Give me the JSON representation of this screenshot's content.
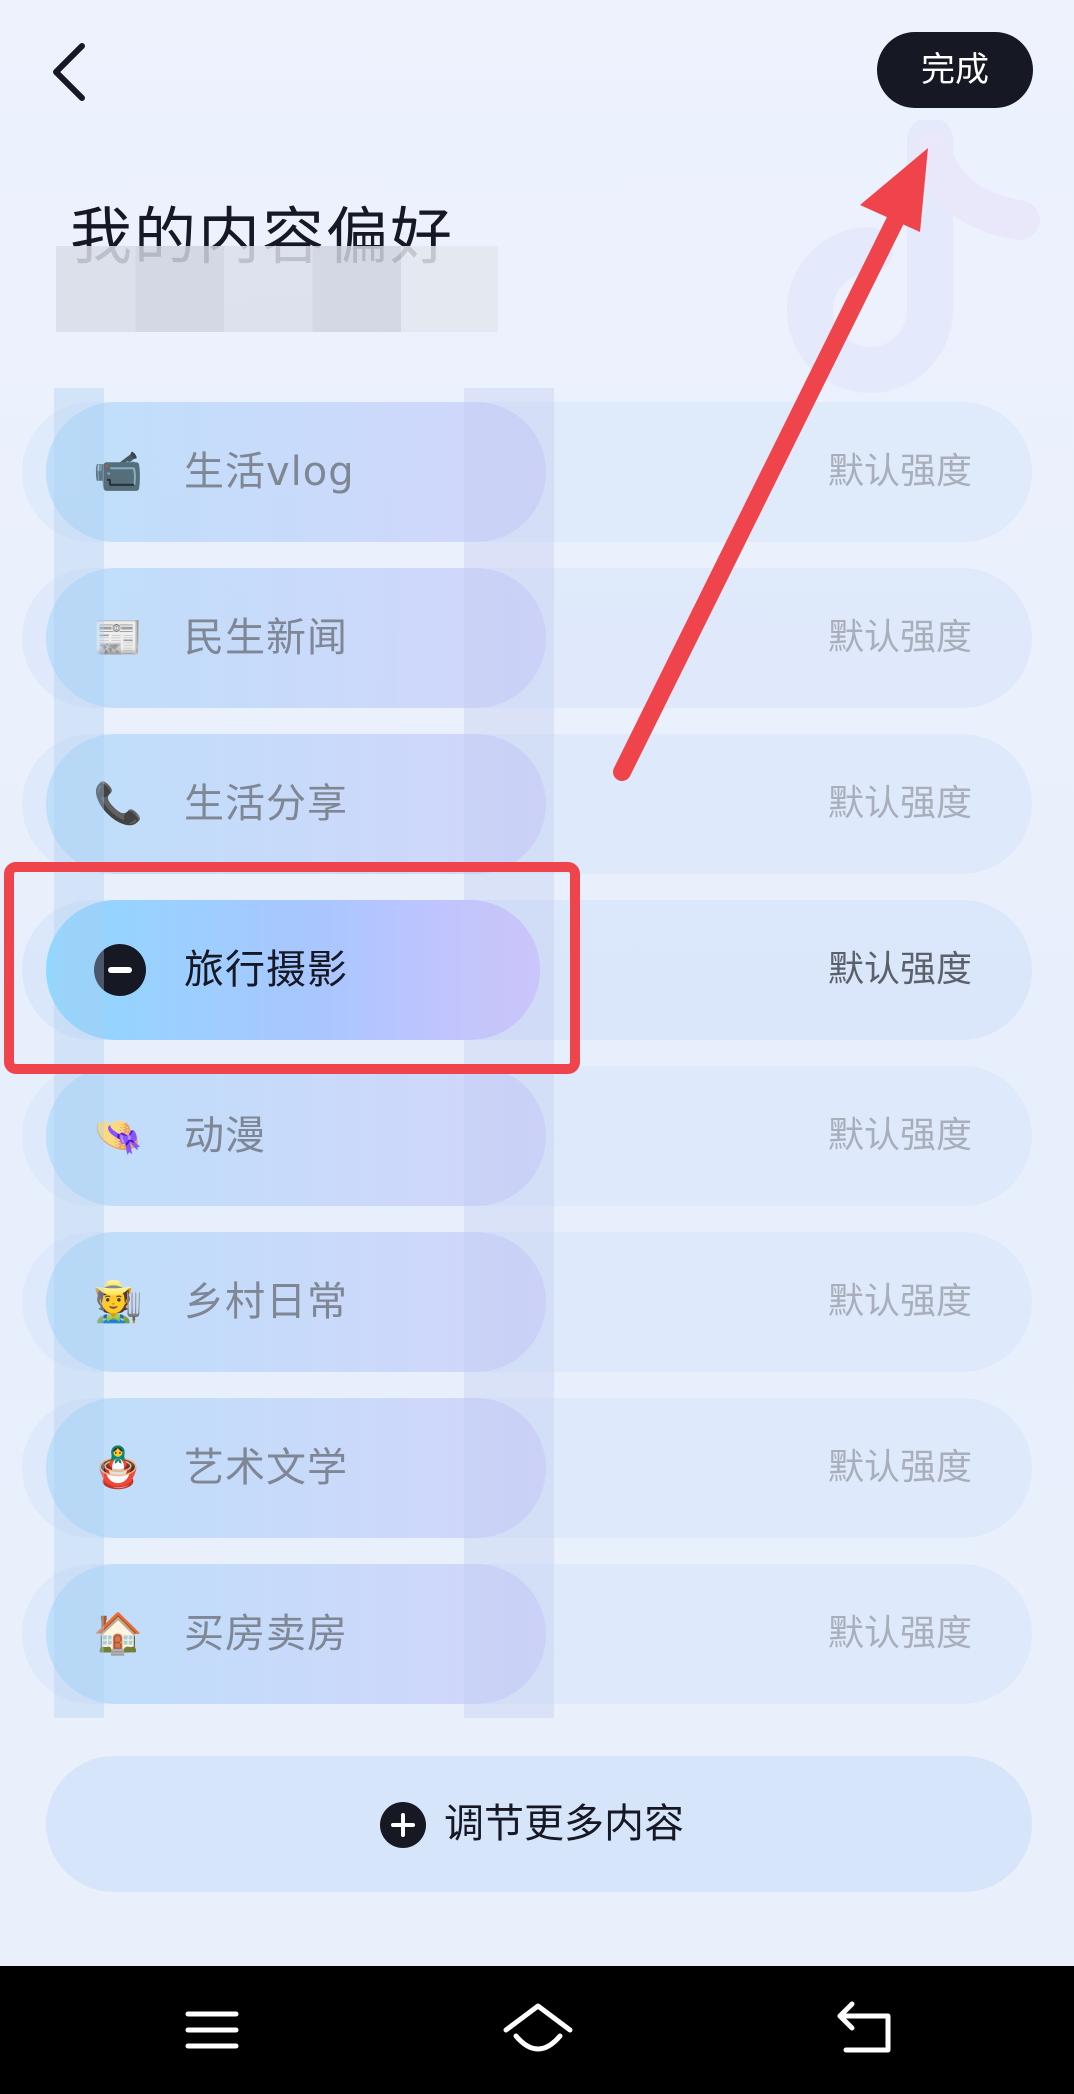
{
  "header": {
    "done_label": "完成",
    "title": "我的内容偏好"
  },
  "preferences": [
    {
      "label": "生活vlog",
      "strength": "默认强度",
      "icon": "camera-icon",
      "glyph": "📹"
    },
    {
      "label": "民生新闻",
      "strength": "默认强度",
      "icon": "newspaper-icon",
      "glyph": "📰"
    },
    {
      "label": "生活分享",
      "strength": "默认强度",
      "icon": "phone-icon",
      "glyph": "📞"
    },
    {
      "label": "旅行摄影",
      "strength": "默认强度",
      "icon": "minus-icon",
      "selected": true
    },
    {
      "label": "动漫",
      "strength": "默认强度",
      "icon": "sun-hat-icon",
      "glyph": "👒"
    },
    {
      "label": "乡村日常",
      "strength": "默认强度",
      "icon": "farmer-icon",
      "glyph": "🧑‍🌾"
    },
    {
      "label": "艺术文学",
      "strength": "默认强度",
      "icon": "art-figure-icon",
      "glyph": "🪆"
    },
    {
      "label": "买房卖房",
      "strength": "默认强度",
      "icon": "house-icon",
      "glyph": "🏠"
    }
  ],
  "more": {
    "label": "调节更多内容",
    "icon": "plus-icon"
  },
  "nav": [
    "menu-icon",
    "home-icon",
    "back-icon"
  ],
  "colors": {
    "accent": "#161823",
    "highlight": "#f0444c"
  }
}
